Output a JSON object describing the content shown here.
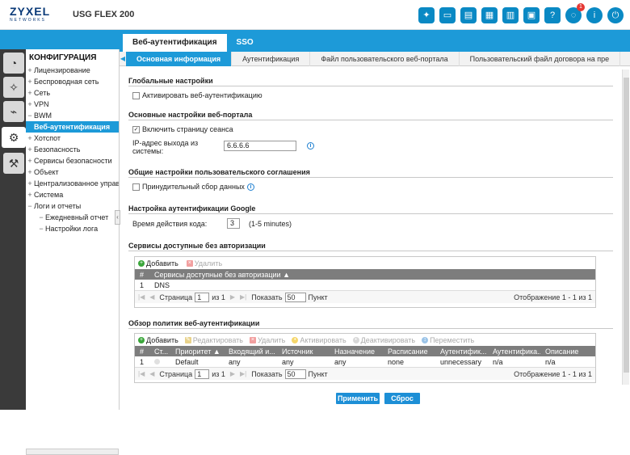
{
  "header": {
    "logo": "ZYXEL",
    "logo_sub": "NETWORKS",
    "model": "USG FLEX 200",
    "notif_count": "1"
  },
  "sidebar": {
    "title": "КОНФИГУРАЦИЯ",
    "items": [
      {
        "pm": "+",
        "label": "Лицензирование"
      },
      {
        "pm": "+",
        "label": "Беспроводная сеть"
      },
      {
        "pm": "+",
        "label": "Сеть"
      },
      {
        "pm": "+",
        "label": "VPN"
      },
      {
        "pm": "−",
        "label": "BWM"
      },
      {
        "pm": "",
        "label": "Веб-аутентификация"
      },
      {
        "pm": "+",
        "label": "Хотспот"
      },
      {
        "pm": "+",
        "label": "Безопасность"
      },
      {
        "pm": "+",
        "label": "Сервисы безопасности"
      },
      {
        "pm": "+",
        "label": "Объект"
      },
      {
        "pm": "+",
        "label": "Централизованное управление"
      },
      {
        "pm": "+",
        "label": "Система"
      },
      {
        "pm": "−",
        "label": "Логи и отчеты"
      },
      {
        "pm": "−",
        "label": "Ежедневный отчет"
      },
      {
        "pm": "−",
        "label": "Настройки лога"
      }
    ]
  },
  "main_tabs": [
    "Веб-аутентификация",
    "SSO"
  ],
  "sub_tabs": [
    "Основная информация",
    "Аутентификация",
    "Файл пользовательского веб-портала",
    "Пользовательский файл договора на пре"
  ],
  "global": {
    "title": "Глобальные настройки",
    "enable_label": "Активировать веб-аутентификацию"
  },
  "portal": {
    "title": "Основные настройки веб-портала",
    "session_label": "Включить страницу сеанса",
    "ip_label_1": "IP-адрес выхода из",
    "ip_label_2": "системы:",
    "ip_value": "6.6.6.6"
  },
  "agreement": {
    "title": "Общие настройки пользовательского соглашения",
    "force_label": "Принудительный сбор данных"
  },
  "google": {
    "title": "Настройка аутентификации Google",
    "code_label": "Время действия кода:",
    "code_value": "3",
    "code_hint": "(1-5 minutes)"
  },
  "services": {
    "title": "Сервисы доступные без авторизации",
    "add": "Добавить",
    "remove": "Удалить",
    "col_num": "#",
    "col_name": "Сервисы доступные без авторизации ▲",
    "rows": [
      {
        "num": "1",
        "name": "DNS"
      }
    ],
    "page_label": "Страница",
    "page": "1",
    "of": "из 1",
    "show": "Показать",
    "per_page": "50",
    "items": "Пункт",
    "display": "Отображение 1 - 1 из 1"
  },
  "policies": {
    "title": "Обзор политик веб-аутентификации",
    "toolbar": [
      "Добавить",
      "Редактировать",
      "Удалить",
      "Активировать",
      "Деактивировать",
      "Переместить"
    ],
    "columns": [
      "#",
      "Ст...",
      "Приоритет ▲",
      "Входящий и...",
      "Источник",
      "Назначение",
      "Расписание",
      "Аутентифик...",
      "Аутентифика...",
      "Описание"
    ],
    "rows": [
      [
        "1",
        "",
        "Default",
        "any",
        "any",
        "any",
        "none",
        "unnecessary",
        "n/a",
        "n/a"
      ]
    ],
    "page_label": "Страница",
    "page": "1",
    "of": "из 1",
    "show": "Показать",
    "per_page": "50",
    "items": "Пункт",
    "display": "Отображение 1 - 1 из 1"
  },
  "footer": {
    "apply": "Применить",
    "reset": "Сброс"
  }
}
